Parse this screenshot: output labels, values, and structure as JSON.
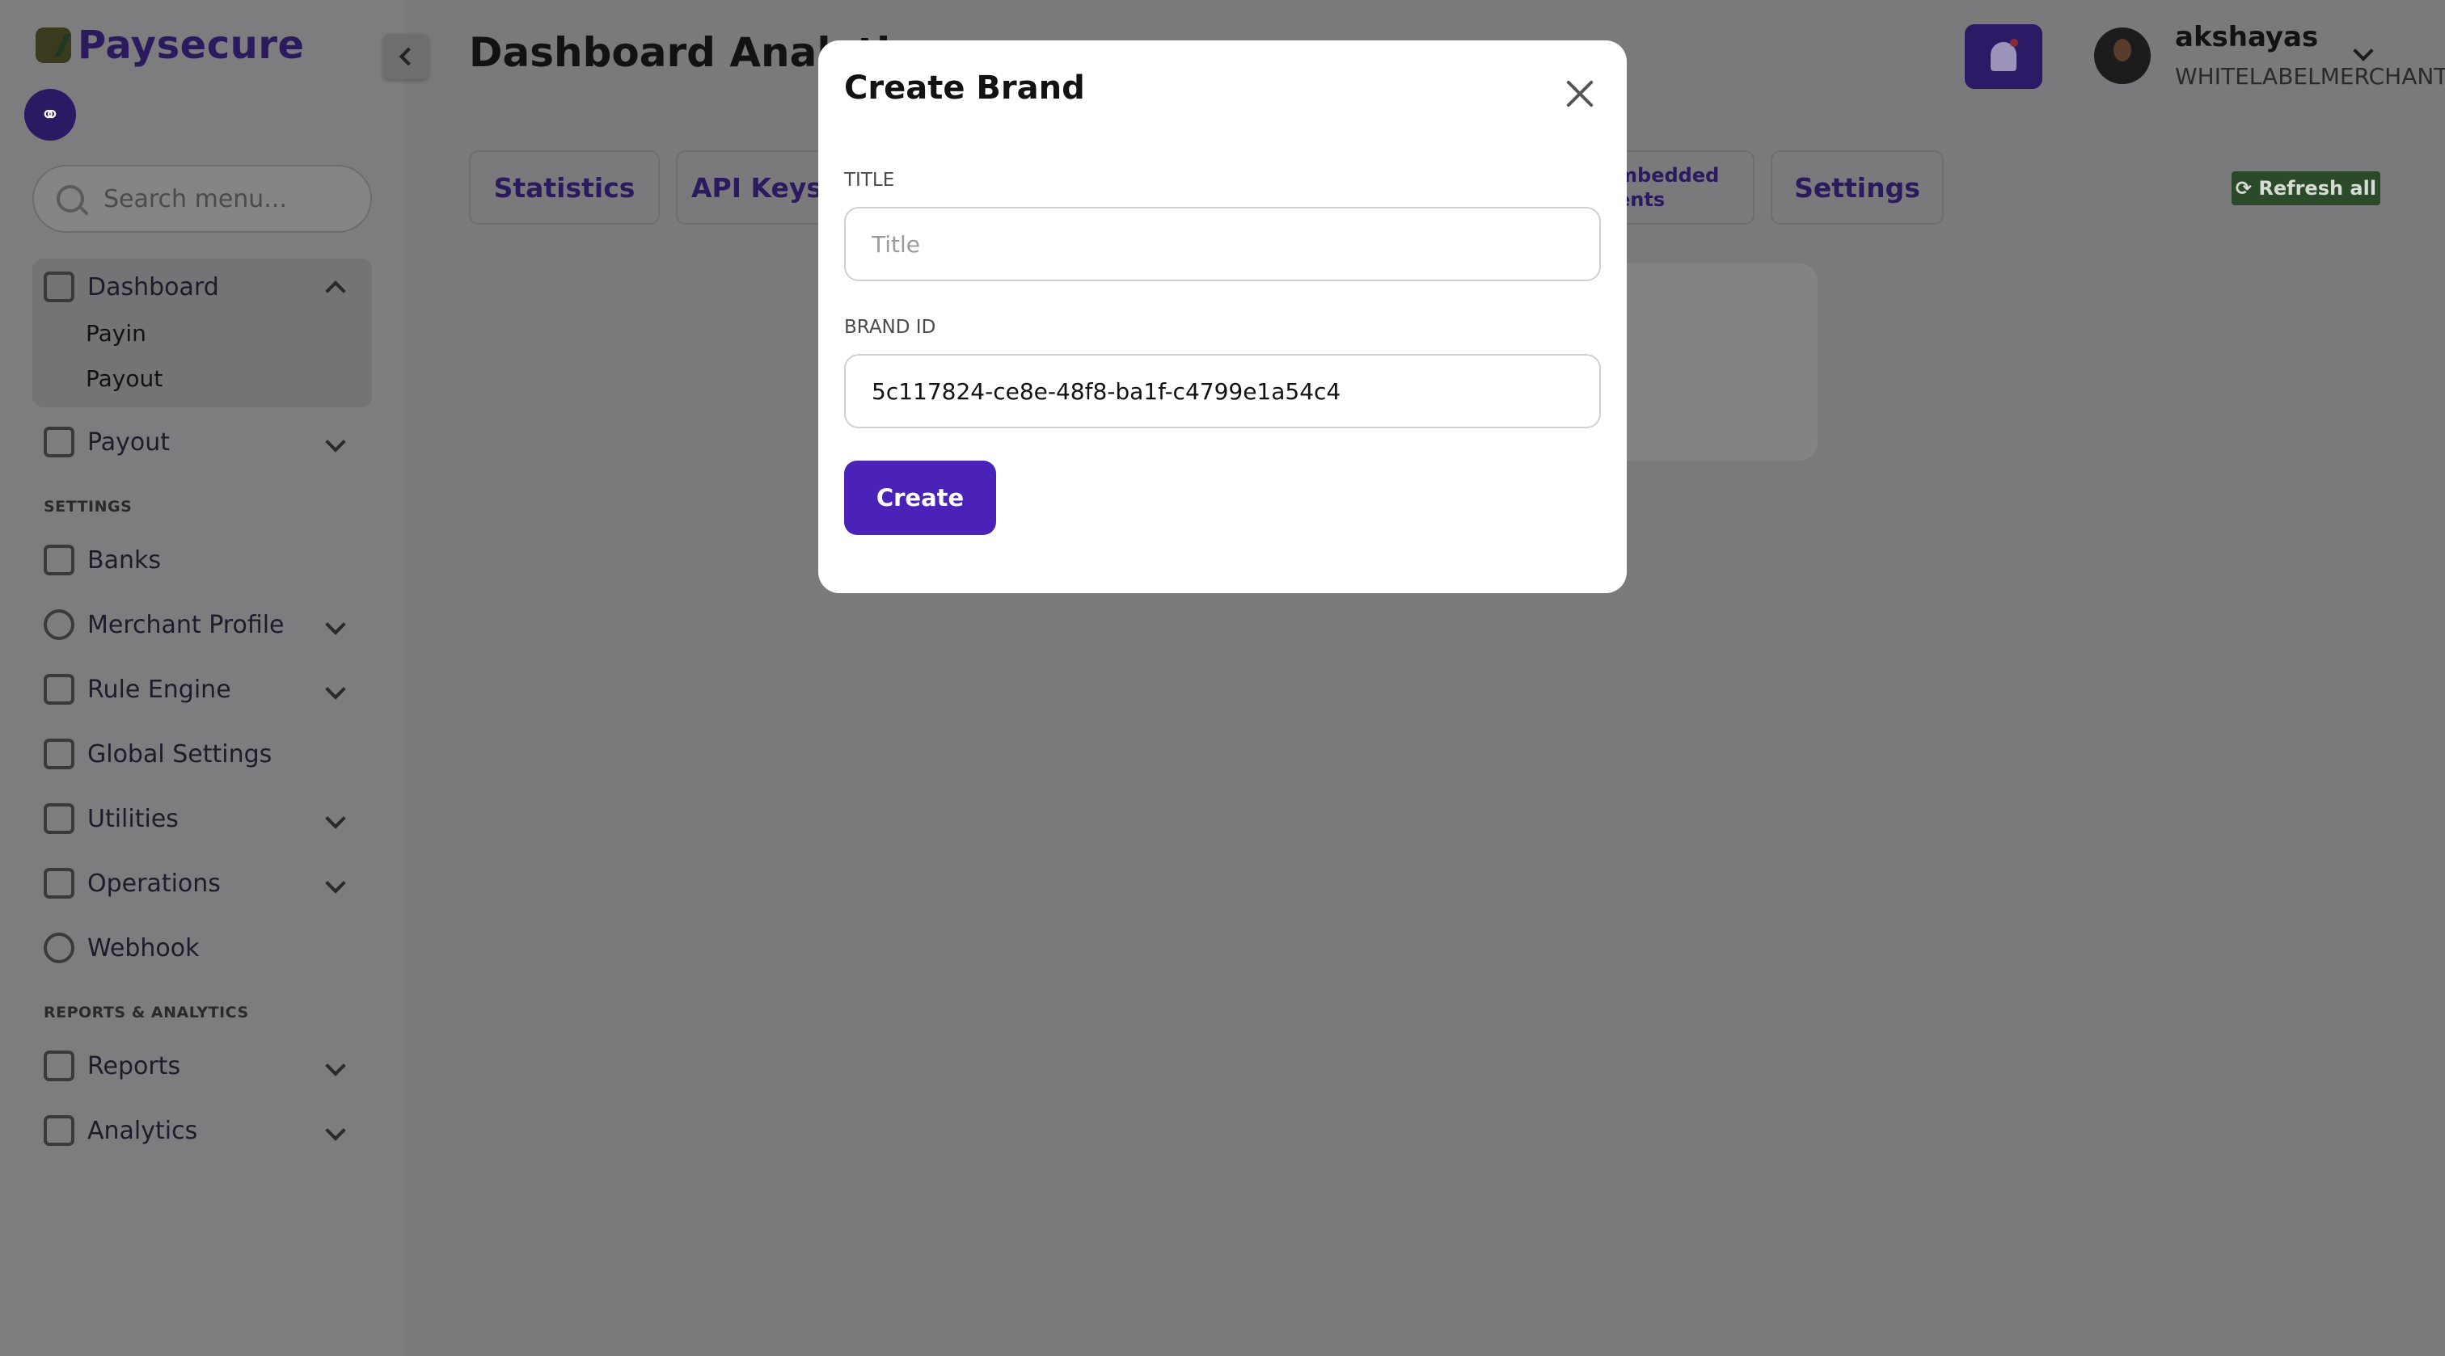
{
  "brand": {
    "name": "Paysecure"
  },
  "sidebar": {
    "search_placeholder": "Search menu...",
    "dashboard": {
      "label": "Dashboard",
      "children": [
        "Payin",
        "Payout"
      ]
    },
    "items": [
      {
        "label": "Payout",
        "icon": "payout-icon"
      },
      {
        "label": "Banks",
        "icon": "bank-icon"
      },
      {
        "label": "Merchant Profile",
        "icon": "user-icon"
      },
      {
        "label": "Rule Engine",
        "icon": "flow-icon"
      },
      {
        "label": "Global Settings",
        "icon": "settings-icon"
      },
      {
        "label": "Utilities",
        "icon": "wand-icon"
      },
      {
        "label": "Operations",
        "icon": "sliders-icon"
      },
      {
        "label": "Webhook",
        "icon": "webhook-icon"
      },
      {
        "label": "Reports",
        "icon": "bar-chart-icon"
      },
      {
        "label": "Analytics",
        "icon": "card-icon"
      }
    ],
    "sections": {
      "settings": "SETTINGS",
      "reports": "REPORTS & ANALYTICS"
    }
  },
  "header": {
    "title": "Dashboard Analytic",
    "user": {
      "name": "akshayas",
      "role": "WHITELABELMERCHANT"
    }
  },
  "tabs": [
    {
      "label": "Statistics"
    },
    {
      "label": "API Keys"
    },
    {
      "label": "mbedded\nents"
    },
    {
      "label": "Settings"
    }
  ],
  "refresh_label": "⟳ Refresh all",
  "colors": {
    "accent": "#4a22b8",
    "brand_dark": "#2c1a5e",
    "refresh_bg": "#2b4a2a"
  },
  "modal": {
    "title": "Create Brand",
    "title_field": {
      "label": "TITLE",
      "placeholder": "Title",
      "value": ""
    },
    "brand_id_field": {
      "label": "BRAND ID",
      "value": "5c117824-ce8e-48f8-ba1f-c4799e1a54c4"
    },
    "submit_label": "Create"
  }
}
